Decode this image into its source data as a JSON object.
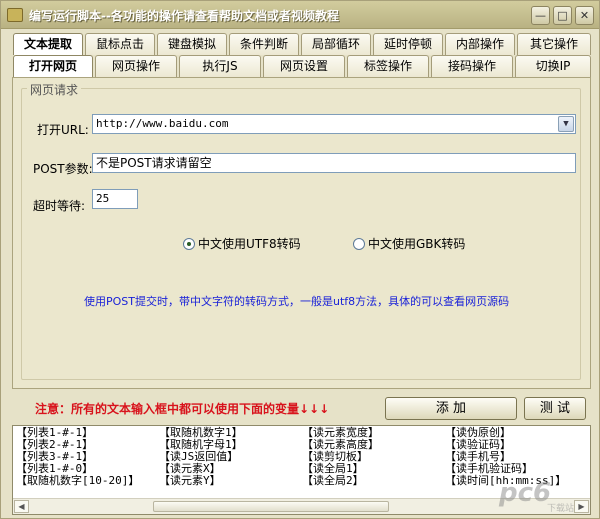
{
  "window": {
    "title": "编写运行脚本--各功能的操作请查看帮助文档或者视频教程"
  },
  "tabs_primary": [
    "文本提取",
    "鼠标点击",
    "键盘模拟",
    "条件判断",
    "局部循环",
    "延时停顿",
    "内部操作",
    "其它操作"
  ],
  "tabs_secondary": [
    "打开网页",
    "网页操作",
    "执行JS",
    "网页设置",
    "标签操作",
    "接码操作",
    "切换IP"
  ],
  "group": {
    "legend": "网页请求"
  },
  "form": {
    "url_label": "打开URL:",
    "url_value": "http://www.baidu.com",
    "post_label": "POST参数:",
    "post_value": "不是POST请求请留空",
    "timeout_label": "超时等待:",
    "timeout_value": "25",
    "radio_utf8": "中文使用UTF8转码",
    "radio_gbk": "中文使用GBK转码",
    "note": "使用POST提交时，带中文字符的转码方式，一般是utf8方法，具体的可以查看网页源码"
  },
  "actions": {
    "warning": "注意：所有的文本输入框中都可以使用下面的变量↓↓↓",
    "add_label": "添 加",
    "test_label": "测 试"
  },
  "variables": {
    "col1": [
      "【列表1-#-1】",
      "【列表2-#-1】",
      "【列表3-#-1】",
      "【列表1-#-0】",
      "【取随机数字[10-20]】"
    ],
    "col2": [
      "【取随机数字1】",
      "【取随机字母1】",
      "【读JS返回值】",
      "【读元素X】",
      "【读元素Y】"
    ],
    "col3": [
      "【读元素宽度】",
      "【读元素高度】",
      "【读剪切板】",
      "【读全局1】",
      "【读全局2】"
    ],
    "col4": [
      "【读伪原创】",
      "【读验证码】",
      "【读手机号】",
      "【读手机验证码】",
      "【读时间[hh:mm:ss]】"
    ]
  },
  "watermark": "pc6下载站"
}
